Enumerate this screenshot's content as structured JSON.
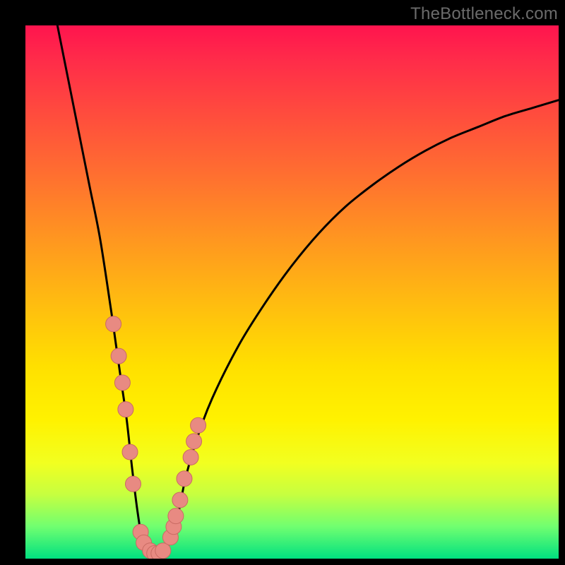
{
  "watermark": "TheBottleneck.com",
  "colors": {
    "frame": "#000000",
    "curve": "#000000",
    "marker_fill": "#e88a82",
    "marker_stroke": "#c96b63",
    "gradient_stops": [
      "#ff144e",
      "#ff2a4a",
      "#ff4a3e",
      "#ff6f30",
      "#ff9620",
      "#ffbc10",
      "#ffe000",
      "#fff200",
      "#f2ff20",
      "#c6ff40",
      "#70ff70",
      "#00e080"
    ]
  },
  "chart_data": {
    "type": "line",
    "title": "",
    "xlabel": "",
    "ylabel": "",
    "xlim": [
      0,
      100
    ],
    "ylim": [
      0,
      100
    ],
    "series": [
      {
        "name": "bottleneck-curve",
        "x": [
          6,
          8,
          10,
          12,
          14,
          16,
          17,
          18,
          19,
          20,
          21,
          22,
          23,
          24,
          25,
          26,
          27,
          28,
          29,
          30,
          32,
          35,
          40,
          45,
          50,
          55,
          60,
          65,
          70,
          75,
          80,
          85,
          90,
          95,
          100
        ],
        "y": [
          100,
          90,
          80,
          70,
          60,
          47,
          40,
          33,
          26,
          17,
          9,
          3,
          1.5,
          1,
          1,
          1.5,
          3,
          6,
          10,
          15,
          22,
          30,
          40,
          48,
          55,
          61,
          66,
          70,
          73.5,
          76.5,
          79,
          81,
          83,
          84.5,
          86
        ]
      }
    ],
    "markers": {
      "name": "highlighted-points",
      "x": [
        16.5,
        17.5,
        18.2,
        18.8,
        19.6,
        20.2,
        21.6,
        22.2,
        23.4,
        24.2,
        25.0,
        25.8,
        27.2,
        27.8,
        28.2,
        29.0,
        29.8,
        31.0,
        31.6,
        32.4
      ],
      "y": [
        44,
        38,
        33,
        28,
        20,
        14,
        5,
        3,
        1.5,
        1,
        1,
        1.5,
        4,
        6,
        8,
        11,
        15,
        19,
        22,
        25
      ]
    }
  }
}
